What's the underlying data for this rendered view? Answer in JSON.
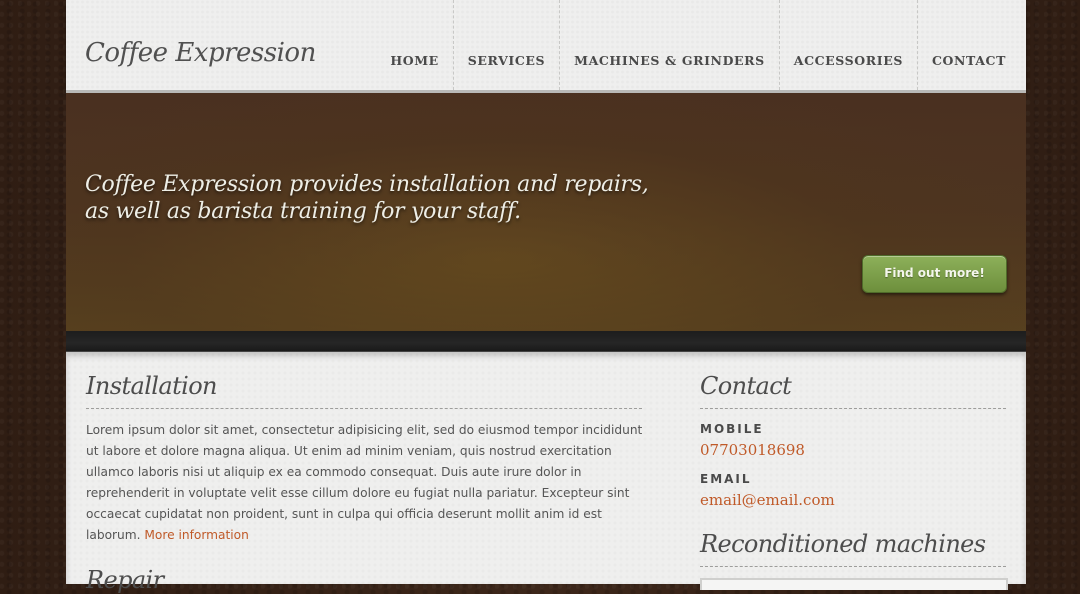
{
  "header": {
    "logo": "Coffee Expression",
    "nav": [
      "HOME",
      "SERVICES",
      "MACHINES & GRINDERS",
      "ACCESSORIES",
      "CONTACT"
    ]
  },
  "hero": {
    "line1": "Coffee Expression provides installation and repairs,",
    "line2": "as well as barista training for your staff.",
    "button": "Find out more!"
  },
  "installation": {
    "title": "Installation",
    "text": "Lorem ipsum dolor sit amet, consectetur adipisicing elit, sed do eiusmod tempor incididunt ut labore et dolore magna aliqua. Ut enim ad minim veniam, quis nostrud exercitation ullamco laboris nisi ut aliquip ex ea commodo consequat. Duis aute irure dolor in reprehenderit in voluptate velit esse cillum dolore eu fugiat nulla pariatur. Excepteur sint occaecat cupidatat non proident, sunt in culpa qui officia deserunt mollit anim id est laborum.",
    "more_link": "More information"
  },
  "repair": {
    "title": "Repair"
  },
  "contact": {
    "title": "Contact",
    "mobile_label": "MOBILE",
    "mobile": "07703018698",
    "email_label": "EMAIL",
    "email": "email@email.com"
  },
  "reconditioned": {
    "title": "Reconditioned machines"
  },
  "colors": {
    "accent_link": "#c05a29",
    "cta_green": "#7a9c47",
    "background_brown": "#3a2519",
    "panel": "#efefee"
  }
}
